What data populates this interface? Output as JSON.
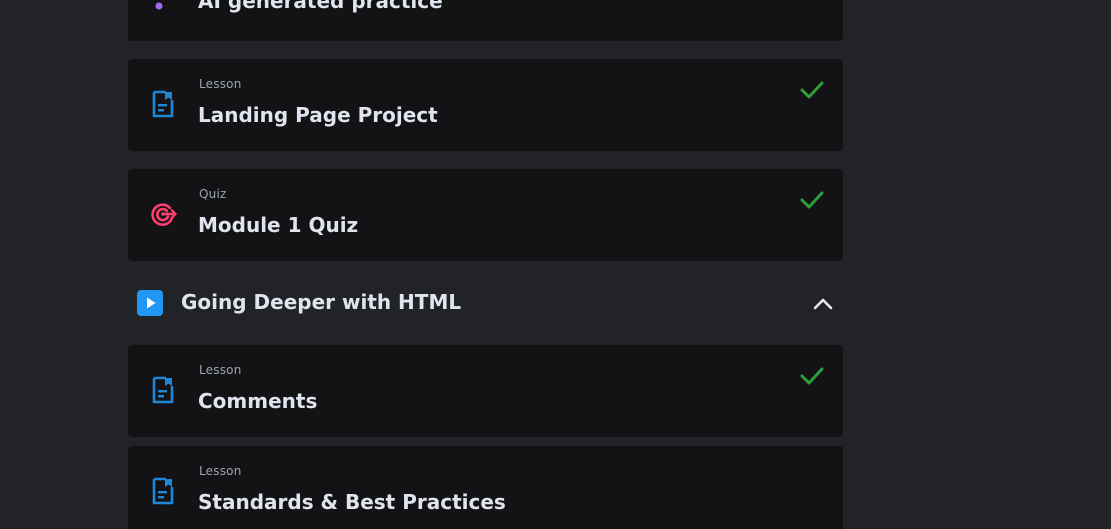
{
  "items_before": [
    {
      "kind": "",
      "title": "AI generated practice"
    },
    {
      "kind": "Lesson",
      "title": "Landing Page Project",
      "icon": "lesson-doc-icon",
      "completed": true
    },
    {
      "kind": "Quiz",
      "title": "Module 1 Quiz",
      "icon": "quiz-target-icon",
      "completed": true
    }
  ],
  "section": {
    "title": "Going Deeper with HTML",
    "icon": "play-icon",
    "toggle_icon": "chevron-up-icon"
  },
  "items_after": [
    {
      "kind": "Lesson",
      "title": "Comments",
      "icon": "lesson-doc-icon",
      "completed": true
    },
    {
      "kind": "Lesson",
      "title": "Standards & Best Practices",
      "icon": "lesson-doc-icon",
      "completed": false
    }
  ],
  "colors": {
    "page_bg": "#222326",
    "card_bg": "#131315",
    "lesson_icon": "#1e88d6",
    "quiz_icon": "#ff3d6e",
    "check": "#2e9e3a",
    "play_bg": "#2196f3",
    "ai_dot": "#a06cf2"
  }
}
